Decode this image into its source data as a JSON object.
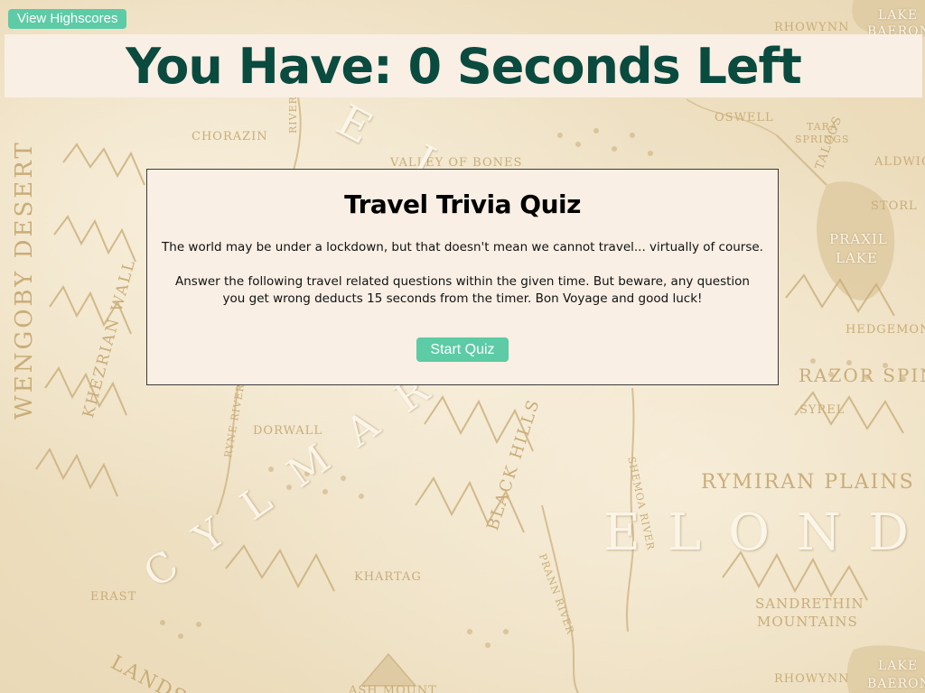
{
  "header": {
    "highscores_label": "View Highscores",
    "timer_text": "You Have: 0 Seconds Left"
  },
  "quiz": {
    "title": "Travel Trivia Quiz",
    "intro": "The world may be under a lockdown, but that doesn't mean we cannot travel... virtually of course.",
    "instructions": "Answer the following travel related questions within the given time. But beware, any question you get wrong deducts 15 seconds from the timer. Bon Voyage and good luck!",
    "start_label": "Start Quiz"
  },
  "map": {
    "labels": {
      "chorazin": "Chorazin",
      "valley_of_bones": "Valley of Bones",
      "oswell": "Oswell",
      "tara_springs_1": "Tara",
      "tara_springs_2": "Springs",
      "aldwic": "Aldwic",
      "storl": "Storl",
      "praxil_1": "Praxil",
      "praxil_2": "Lake",
      "hedgemont": "Hedgemont",
      "razor_spine": "Razor Spin",
      "syrel": "Syrel",
      "rhowynn_top": "Rhowynn",
      "lake_baeron_top_1": "Lake",
      "lake_baeron_top_2": "Baeron",
      "wengoby_desert": "Wengoby Desert",
      "khezrian_wall": "Khezrian Wall",
      "dorwall": "Dorwall",
      "ryne_river": "Ryne River",
      "black_hills": "Black Hills",
      "shemoa_river": "Shemoa River",
      "rymiran_plains": "Rymiran Plains",
      "elonde": "Elonde",
      "cylmar": "Cylmar",
      "eld": "Eld",
      "khartag": "Khartag",
      "prann_river": "Prann River",
      "erast": "Erast",
      "sandrethin_1": "Sandrethin",
      "sandrethin_2": "Mountains",
      "rhowynn_bottom": "Rhowynn",
      "lake_baeron_bottom_1": "Lake",
      "lake_baeron_bottom_2": "Baeron",
      "lands": "Lands",
      "ash_mount": "Ash Mount",
      "taloos": "Taloos",
      "river_top": "River"
    }
  },
  "colors": {
    "accent_button": "#5ccba6",
    "timer_text": "#0a4a3f",
    "panel_bg": "#f9efe4",
    "map_ink": "#c9ad78"
  }
}
